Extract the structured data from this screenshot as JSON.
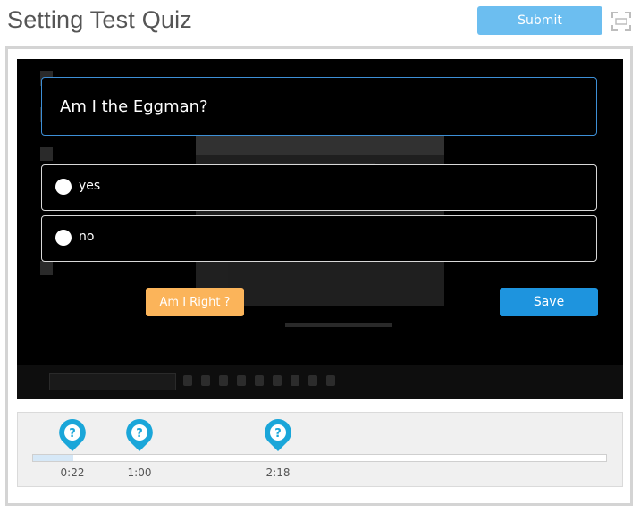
{
  "header": {
    "title": "Setting Test Quiz",
    "submit_label": "Submit",
    "fullscreen_icon": "fullscreen-icon"
  },
  "quiz": {
    "question": "Am I the Eggman?",
    "options": [
      {
        "label": "yes",
        "selected": false
      },
      {
        "label": "no",
        "selected": false
      }
    ],
    "am_i_right_label": "Am I Right ?",
    "save_label": "Save"
  },
  "timeline": {
    "progress_fraction": 0.07,
    "markers": [
      {
        "time": "0:22",
        "icon": "question-marker-icon"
      },
      {
        "time": "1:00",
        "icon": "question-marker-icon"
      },
      {
        "time": "2:18",
        "icon": "question-marker-icon"
      }
    ]
  },
  "colors": {
    "submit": "#6cbef0",
    "save": "#1e94de",
    "am_i_right": "#fbb45a",
    "marker": "#1aa6d9",
    "question_border": "#3d8fd6"
  }
}
